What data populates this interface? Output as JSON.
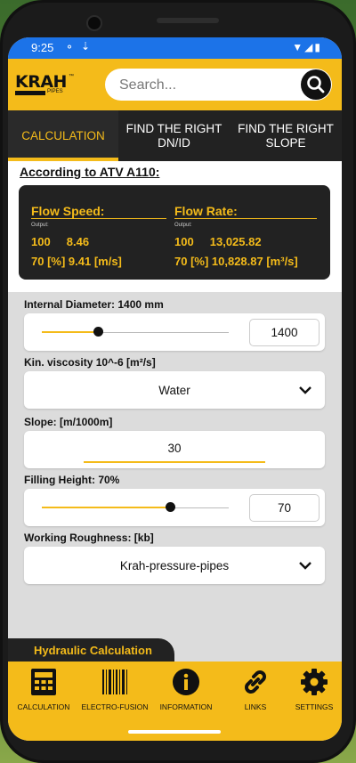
{
  "status_bar": {
    "time": "9:25"
  },
  "header": {
    "logo_text": "KRAH",
    "logo_subtext": "PIPES",
    "search_placeholder": "Search..."
  },
  "tabs": [
    {
      "label": "CALCULATION",
      "active": true
    },
    {
      "label": "FIND THE RIGHT\nDN/ID",
      "active": false
    },
    {
      "label": "FIND THE RIGHT\nSLOPE",
      "active": false
    }
  ],
  "results": {
    "heading": "According to ATV A110:",
    "flow_speed": {
      "title": "Flow Speed:",
      "output_label": "Output:",
      "row1": "100     8.46",
      "row2": "70 [%] 9.41 [m/s]"
    },
    "flow_rate": {
      "title": "Flow Rate:",
      "output_label": "Output:",
      "row1": "100     13,025.82",
      "row2": "70 [%] 10,828.87 [m³/s]"
    }
  },
  "form": {
    "internal_diameter": {
      "label": "Internal Diameter: 1400 mm",
      "value": "1400",
      "level": 0.3
    },
    "viscosity": {
      "label": "Kin. viscosity 10^-6 [m²/s]",
      "selected": "Water"
    },
    "slope": {
      "label": "Slope: [m/1000m]",
      "value": "30"
    },
    "filling_height": {
      "label": "Filling Height: 70%",
      "value": "70",
      "level": 0.69
    },
    "roughness": {
      "label": "Working Roughness: [kb]",
      "selected": "Krah-pressure-pipes"
    }
  },
  "section_tab": {
    "label": "Hydraulic Calculation"
  },
  "bottom_nav": [
    {
      "label": "CALCULATION",
      "icon": "calculator-icon"
    },
    {
      "label": "ELECTRO-FUSION",
      "icon": "barcode-icon"
    },
    {
      "label": "INFORMATION",
      "icon": "info-icon"
    },
    {
      "label": "LINKS",
      "icon": "link-icon"
    },
    {
      "label": "SETTINGS",
      "icon": "gear-icon"
    }
  ],
  "colors": {
    "accent": "#f4bb1a",
    "dark": "#222222",
    "status_bar": "#1c73e8"
  }
}
